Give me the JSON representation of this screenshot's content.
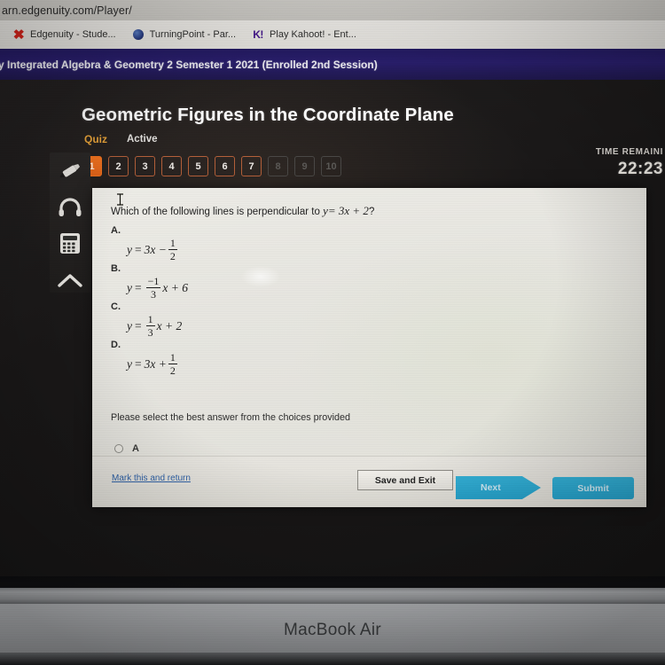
{
  "browser": {
    "url": "arn.edgenuity.com/Player/",
    "bookmarks": [
      {
        "label": "Edgenuity - Stude...",
        "icon": "edgenuity-x-icon"
      },
      {
        "label": "TurningPoint - Par...",
        "icon": "globe-icon"
      },
      {
        "label": "Play Kahoot! - Ent...",
        "icon": "kahoot-k-icon"
      }
    ]
  },
  "course_banner": {
    "text": "y Integrated Algebra & Geometry 2 Semester 1 2021 (Enrolled 2nd Session)"
  },
  "header": {
    "title": "Geometric Figures in the Coordinate Plane",
    "type_label": "Quiz",
    "status_label": "Active",
    "time_label": "TIME REMAINI",
    "time_value": "22:23"
  },
  "pager": {
    "items": [
      {
        "label": "1",
        "state": "active"
      },
      {
        "label": "2",
        "state": "available"
      },
      {
        "label": "3",
        "state": "available"
      },
      {
        "label": "4",
        "state": "available"
      },
      {
        "label": "5",
        "state": "available"
      },
      {
        "label": "6",
        "state": "available"
      },
      {
        "label": "7",
        "state": "available"
      },
      {
        "label": "8",
        "state": "disabled"
      },
      {
        "label": "9",
        "state": "disabled"
      },
      {
        "label": "10",
        "state": "disabled"
      }
    ]
  },
  "tools": [
    {
      "name": "highlighter-icon"
    },
    {
      "name": "headphones-icon"
    },
    {
      "name": "calculator-icon"
    },
    {
      "name": "collapse-up-icon"
    }
  ],
  "question": {
    "prompt_prefix": "Which of the following lines is perpendicular to ",
    "prompt_equation_y": "y",
    "prompt_equation_rest": "= 3x + 2",
    "prompt_suffix": "?",
    "choices": [
      {
        "letter": "A.",
        "lhs": "y",
        "eq": "=",
        "terms": "3x −",
        "frac_num": "1",
        "frac_den": "2",
        "tail": ""
      },
      {
        "letter": "B.",
        "lhs": "y",
        "eq": "=",
        "terms": "",
        "frac_num": "−1",
        "frac_den": "3",
        "tail": "x + 6"
      },
      {
        "letter": "C.",
        "lhs": "y",
        "eq": "=",
        "terms": "",
        "frac_num": "1",
        "frac_den": "3",
        "tail": "x + 2"
      },
      {
        "letter": "D.",
        "lhs": "y",
        "eq": "=",
        "terms": "3x +",
        "frac_num": "1",
        "frac_den": "2",
        "tail": ""
      }
    ],
    "instruction": "Please select the best answer from the choices provided",
    "selected_answer_label": "A"
  },
  "footer": {
    "mark_link": "Mark this and return",
    "save_label": "Save and Exit",
    "next_label": "Next",
    "submit_label": "Submit"
  },
  "device": {
    "brand_label": "MacBook Air"
  },
  "colors": {
    "accent_orange": "#f2731f",
    "accent_blue": "#29abd4",
    "banner_navy": "#241a63",
    "quiz_gold": "#e8a33a",
    "link_blue": "#2f62a8"
  }
}
